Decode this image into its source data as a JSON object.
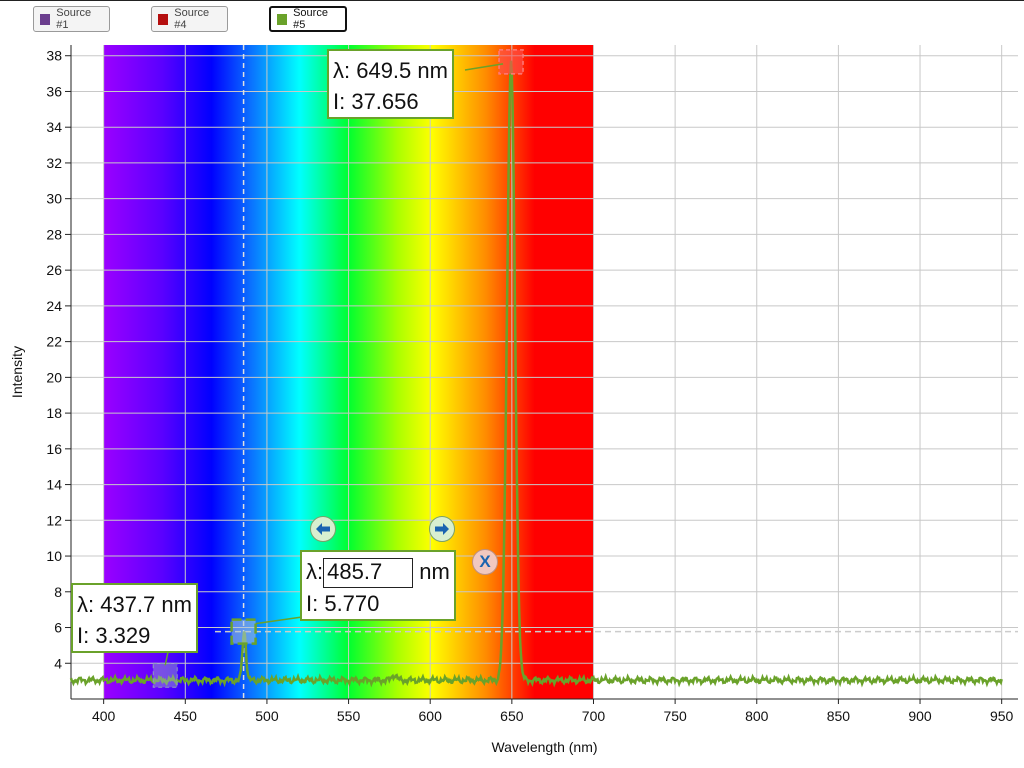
{
  "sources": [
    {
      "label": "Source #1",
      "color": "#6b3e8e",
      "active": false
    },
    {
      "label": "Source #4",
      "color": "#b50f0f",
      "active": false
    },
    {
      "label": "Source #5",
      "color": "#6aa22a",
      "active": true
    }
  ],
  "tooltips": {
    "peak_high": {
      "lambda": "λ: 649.5 nm",
      "intensity": "I: 37.656"
    },
    "marker_left": {
      "lambda": "λ: 437.7 nm",
      "intensity": "I: 3.329"
    },
    "marker_edit": {
      "lambda_prefix": "λ:",
      "lambda_value": "485.7",
      "unit": "nm",
      "intensity": "I: 5.770"
    }
  },
  "controls": {
    "prev_icon": "arrow-left-icon",
    "next_icon": "arrow-right-icon",
    "close_label": "X"
  },
  "chart_data": {
    "type": "line",
    "xlabel": "Wavelength (nm)",
    "ylabel": "Intensity",
    "xlim": [
      380,
      960
    ],
    "ylim": [
      2,
      38.6
    ],
    "xticks": [
      400,
      450,
      500,
      550,
      600,
      650,
      700,
      750,
      800,
      850,
      900,
      950
    ],
    "yticks": [
      4,
      6,
      8,
      10,
      12,
      14,
      16,
      18,
      20,
      22,
      24,
      26,
      28,
      30,
      32,
      34,
      36,
      38
    ],
    "grid": true,
    "visible_spectrum_band": [
      400,
      700
    ],
    "reference_line": {
      "x": 485.7,
      "y": 5.77
    },
    "markers": [
      {
        "x": 437.7,
        "y": 3.329
      },
      {
        "x": 485.7,
        "y": 5.77
      },
      {
        "x": 649.5,
        "y": 37.656
      }
    ],
    "series": [
      {
        "name": "Source #5",
        "color": "#6aa22a",
        "baseline": 3.05,
        "peaks": [
          {
            "center": 486.1,
            "height": 2.75,
            "width": 1.1
          },
          {
            "center": 649.5,
            "height": 34.6,
            "width": 2.4
          },
          {
            "center": 645.5,
            "height": 0.5,
            "width": 1.6
          },
          {
            "center": 578,
            "height": 0.3,
            "width": 1.5
          }
        ]
      }
    ]
  }
}
